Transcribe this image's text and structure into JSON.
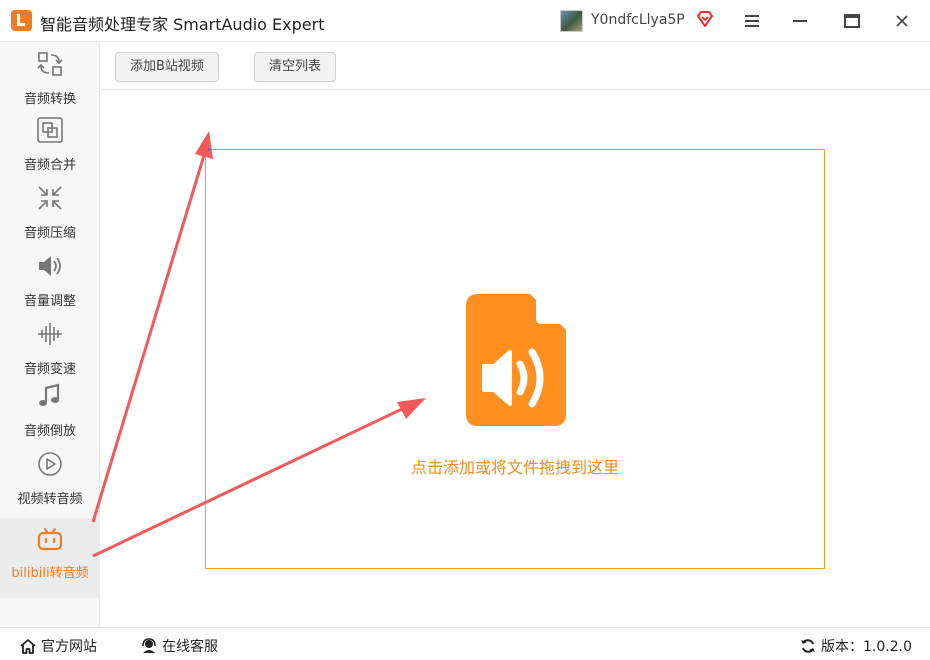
{
  "app": {
    "title": "智能音频处理专家 SmartAudio Expert",
    "username": "Y0ndfcLlya5P",
    "accent_color": "#f07b22"
  },
  "sidebar": {
    "items": [
      {
        "label": "音频转换",
        "icon": "convert-icon"
      },
      {
        "label": "音频合并",
        "icon": "merge-icon"
      },
      {
        "label": "音频压缩",
        "icon": "compress-icon"
      },
      {
        "label": "音量调整",
        "icon": "volume-icon"
      },
      {
        "label": "音频变速",
        "icon": "speed-icon"
      },
      {
        "label": "音频倒放",
        "icon": "reverse-icon"
      },
      {
        "label": "视频转音频",
        "icon": "video-to-audio-icon"
      },
      {
        "label": "bilibili转音频",
        "icon": "bilibili-icon",
        "active": true
      }
    ]
  },
  "toolbar": {
    "add_label": "添加B站视频",
    "clear_label": "清空列表"
  },
  "dropzone": {
    "hint": "点击添加或将文件拖拽到这里",
    "icon": "audio-file-icon"
  },
  "footer": {
    "website_label": "官方网站",
    "support_label": "在线客服",
    "version_label": "版本：1.0.2.0"
  }
}
